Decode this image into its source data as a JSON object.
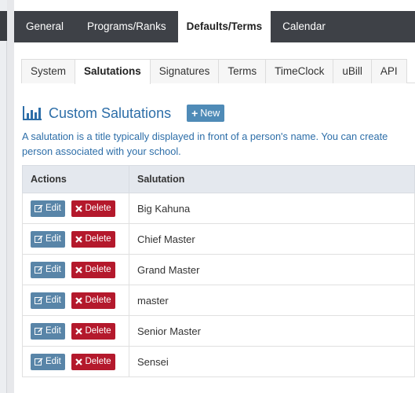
{
  "top_nav": {
    "tabs": [
      "General",
      "Programs/Ranks",
      "Defaults/Terms",
      "Calendar"
    ],
    "active": "Defaults/Terms"
  },
  "sub_nav": {
    "tabs": [
      "System",
      "Salutations",
      "Signatures",
      "Terms",
      "TimeClock",
      "uBill",
      "API"
    ],
    "active": "Salutations"
  },
  "section": {
    "title": "Custom Salutations",
    "new_label": "New",
    "description_line1": "A salutation is a title typically displayed in front of a person's name. You can create",
    "description_line2": "person associated with your school."
  },
  "table": {
    "headers": {
      "actions": "Actions",
      "salutation": "Salutation"
    },
    "edit_label": "Edit",
    "delete_label": "Delete",
    "rows": [
      "Big Kahuna",
      "Chief Master",
      "Grand Master",
      "master",
      "Senior Master",
      "Sensei"
    ]
  },
  "colors": {
    "nav_bg": "#3e4147",
    "accent_blue": "#2d6ea8",
    "edit_btn": "#5985a8",
    "delete_btn": "#b4192c",
    "new_btn": "#4f8bb7"
  }
}
